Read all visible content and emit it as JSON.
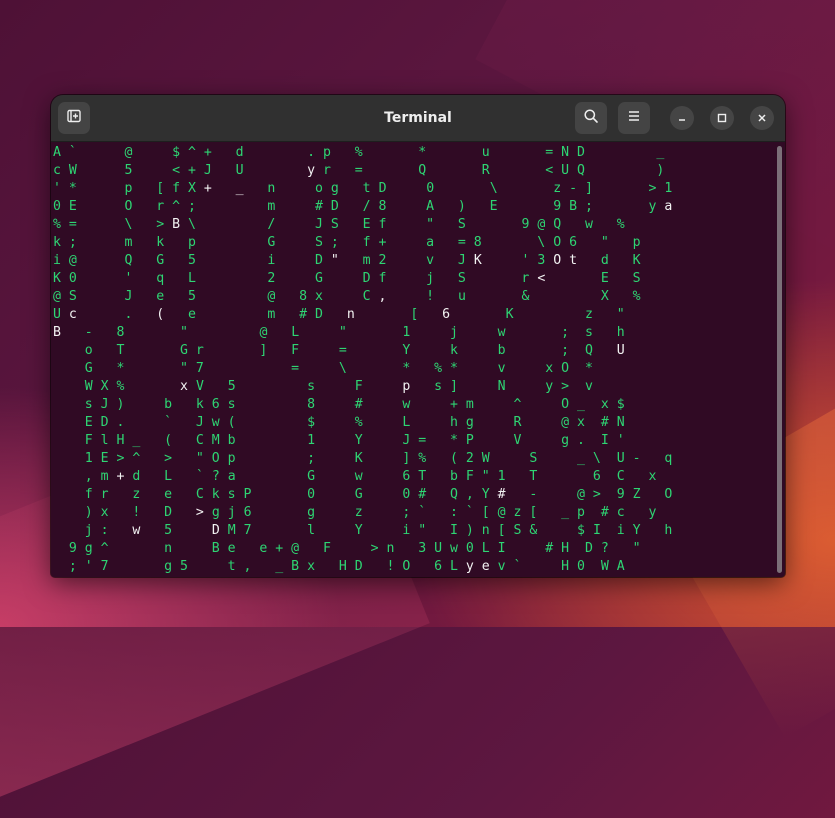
{
  "window": {
    "title": "Terminal",
    "buttons": {
      "new_tab": "new-tab-icon",
      "search": "search-icon",
      "menu": "menu-icon",
      "minimize": "minimize-icon",
      "maximize": "maximize-icon",
      "close": "close-icon"
    }
  },
  "terminal": {
    "colors": {
      "background": "#300a24",
      "rain": "#2ed573",
      "head": "#f2f2f2"
    },
    "rows": [
      [
        "A `      @     $ ^ +   d        . p   %       *       u       = N D         _",
        ""
      ],
      [
        "c W      5     < + J   U        ",
        "y",
        " r   =       Q       R       < U Q         )",
        ""
      ],
      [
        "' *      p   [ f X ",
        "+",
        "   ",
        "_",
        "   n     o g   t D     0       \\       z - ]       > 1",
        ""
      ],
      [
        "0 E      O   r ^ ;         m     # D   / 8     A   )   E       9 B ;       y ",
        "a",
        ""
      ],
      [
        "% =      \\   > ",
        "B",
        " \\         /     J S   E f     \"   S       9 @ Q   w   %",
        ""
      ],
      [
        "k ;      m   k   p         G     S ;   f +     a   = 8       \\ O 6   \"   p",
        ""
      ],
      [
        "i @      Q   G   5         i     D ",
        "\"",
        "   m 2     v   J ",
        "K",
        "     ' 3 ",
        "O t",
        "   d   K",
        ""
      ],
      [
        "K 0      '   q   L         2     G     D f     j   S       r ",
        "<",
        "       E   S",
        ""
      ],
      [
        "@ S      J   e   5         @   8 x     C ",
        ",",
        "     !   u       &         X   %",
        ""
      ],
      [
        "U ",
        "c",
        "      .   ",
        "(",
        "   e         m   # D   ",
        "n",
        "       [   ",
        "6",
        "       K         z   \"",
        ""
      ],
      [
        "",
        "B",
        "   -   8       \"         @   L     \"       1     j     w       ;  s   h",
        ""
      ],
      [
        "    o   T       G r       ]   F     =       Y     k     b       ;  Q   ",
        "U",
        ""
      ],
      [
        "    G   *       \" 7           =     \\       *   % *     v     x O  *",
        ""
      ],
      [
        "    W X %       ",
        "x",
        " V   5         s     F     ",
        "p",
        "   s ]     N     y >  v",
        ""
      ],
      [
        "    s J )     b   k 6 s         8     #     w     + m     ^     O _  x $",
        ""
      ],
      [
        "    E D .     `   J w (         $     %     L     h g     R     @ x  # N",
        ""
      ],
      [
        "    F l H _   (   C M b         1     Y     J =   * P     V     g .  I '",
        ""
      ],
      [
        "    1 E > ^   >   \" O p         ;     K     ] %   ( 2 W     S     _ \\  U -   q",
        ""
      ],
      [
        "    , m ",
        "+",
        " d   L   ` ? a         G     w     6 T   b F \" 1   T       6  C   x",
        ""
      ],
      [
        "    f r   z   e   C k s P       0     G     0 #   Q , Y ",
        "#",
        "   -     @ >  9 Z   O",
        ""
      ],
      [
        "    ) x   !   D   ",
        ">",
        " g j 6       g     z     ; `   : ` [ @ z [   _ p  # c   y",
        ""
      ],
      [
        "    j :   ",
        "w",
        "   5     ",
        "D",
        " M 7       l     Y     i \"   I ) n [ S &     $ I  i Y   h",
        ""
      ],
      [
        "  9 g ^       n     B e   e + @   F     > n   3 U w 0 L I     # H  D ?   \"",
        ""
      ],
      [
        "  ; ' 7       g 5     t ,   _ B x   H D   ! O   6 L ",
        "y e",
        " v `     H 0  W A",
        ""
      ]
    ]
  }
}
